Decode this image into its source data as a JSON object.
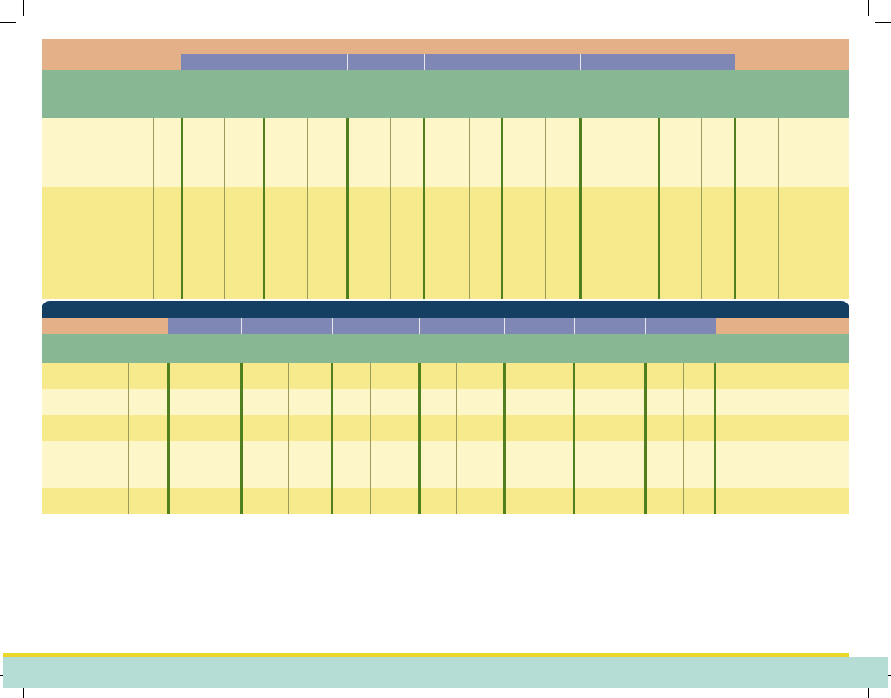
{
  "colors": {
    "header_band": "#e4b088",
    "subheader": "#7f88b5",
    "title_band": "#88b794",
    "row_light": "#fdf6c8",
    "row_dark": "#f7ea8d",
    "dark_band": "#153e63",
    "thin_line": "#9a9a5a",
    "thick_line": "#4f7f1f",
    "footer_rule": "#edd62a",
    "footer_band": "#b6ddd5"
  },
  "table1": {
    "subheader_cells": 7,
    "rows": 2
  },
  "table2": {
    "subheader_cells": 7,
    "rows": 5
  }
}
